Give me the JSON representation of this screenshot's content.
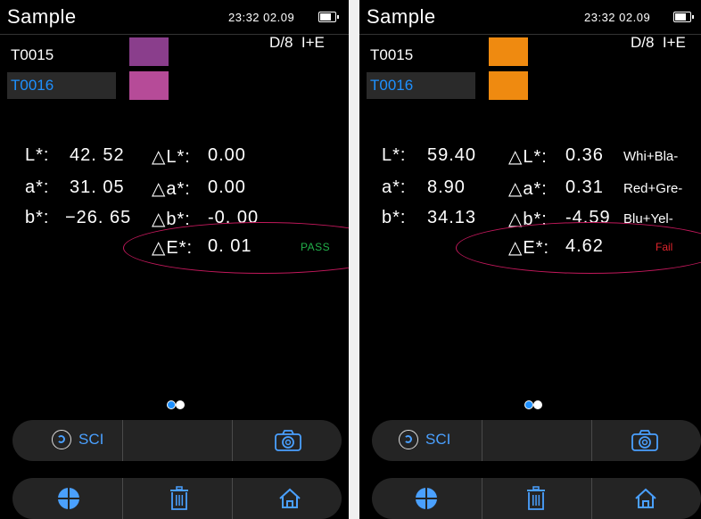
{
  "screens": [
    {
      "title": "Sample",
      "time": "23:32 02.09",
      "mode": "D/8  I+E",
      "samples": [
        {
          "name": "T0015",
          "color": "#8a3e8c",
          "selected": false
        },
        {
          "name": "T0016",
          "color": "#b64b98",
          "selected": true
        }
      ],
      "lab": [
        {
          "label": "L*:",
          "value": "42. 52",
          "delta_label": "△L*:",
          "delta_value": "0.00",
          "desc": ""
        },
        {
          "label": "a*:",
          "value": "31. 05",
          "delta_label": "△a*:",
          "delta_value": "0.00",
          "desc": ""
        },
        {
          "label": "b*:",
          "value": "−26. 65",
          "delta_label": "△b*:",
          "delta_value": "-0. 00",
          "desc": ""
        }
      ],
      "delta_e": {
        "label": "△E*:",
        "value": "0. 01"
      },
      "result": "PASS",
      "result_color": "#22b04a",
      "page_indicator": {
        "current": 1,
        "total": 2
      },
      "toolbar_top": {
        "sci_label": "SCI",
        "icons": [
          "sci-mode-icon",
          "camera-icon"
        ]
      },
      "toolbar_bottom": {
        "icons": [
          "crosshair-icon",
          "trash-icon",
          "home-icon"
        ]
      }
    },
    {
      "title": "Sample",
      "time": "23:32 02.09",
      "mode": "D/8  I+E",
      "samples": [
        {
          "name": "T0015",
          "color": "#ef8a10",
          "selected": false
        },
        {
          "name": "T0016",
          "color": "#ef8a10",
          "selected": true
        }
      ],
      "lab": [
        {
          "label": "L*:",
          "value": "59.40",
          "delta_label": "△L*:",
          "delta_value": "0.36",
          "desc": "Whi+Bla-"
        },
        {
          "label": "a*:",
          "value": "8.90",
          "delta_label": "△a*:",
          "delta_value": "0.31",
          "desc": "Red+Gre-"
        },
        {
          "label": "b*:",
          "value": "34.13",
          "delta_label": "△b*:",
          "delta_value": "-4.59",
          "desc": "Blu+Yel-"
        }
      ],
      "delta_e": {
        "label": "△E*:",
        "value": "4.62"
      },
      "result": "Fail",
      "result_color": "#e0242c",
      "page_indicator": {
        "current": 1,
        "total": 2
      },
      "toolbar_top": {
        "sci_label": "SCI",
        "icons": [
          "sci-mode-icon",
          "camera-icon"
        ]
      },
      "toolbar_bottom": {
        "icons": [
          "crosshair-icon",
          "trash-icon",
          "home-icon"
        ]
      }
    }
  ],
  "annotation_color": "#c2185b"
}
